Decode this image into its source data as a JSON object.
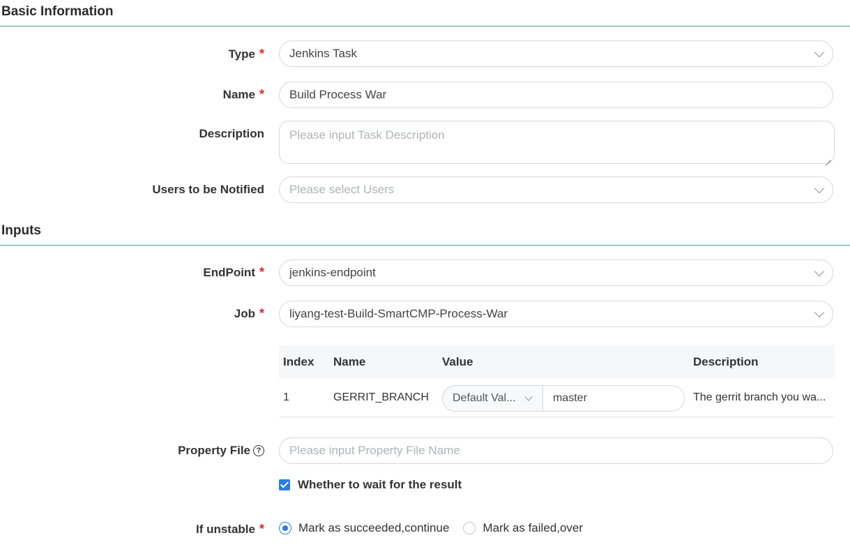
{
  "sections": {
    "basic": "Basic Information",
    "inputs": "Inputs"
  },
  "fields": {
    "type": {
      "label": "Type",
      "value": "Jenkins Task"
    },
    "name": {
      "label": "Name",
      "value": "Build Process War"
    },
    "description": {
      "label": "Description",
      "placeholder": "Please input Task Description"
    },
    "users": {
      "label": "Users to be Notified",
      "placeholder": "Please select Users"
    },
    "endpoint": {
      "label": "EndPoint",
      "value": "jenkins-endpoint"
    },
    "job": {
      "label": "Job",
      "value": "liyang-test-Build-SmartCMP-Process-War"
    },
    "property_file": {
      "label": "Property File",
      "placeholder": "Please input Property File Name"
    }
  },
  "required_mark": "*",
  "help_icon": "?",
  "params_table": {
    "headers": [
      "Index",
      "Name",
      "Value",
      "Description"
    ],
    "rows": [
      {
        "index": "1",
        "name": "GERRIT_BRANCH",
        "value_mode": "Default Val...",
        "value": "master",
        "description": "The gerrit branch you wa..."
      }
    ]
  },
  "wait_result": {
    "label": "Whether to wait for the result",
    "checked": true
  },
  "if_unstable": {
    "label": "If unstable",
    "options": [
      "Mark as succeeded,continue",
      "Mark as failed,over"
    ],
    "selected": 0
  },
  "colors": {
    "accent": "#2a7de1",
    "divider": "#3aa39b",
    "required": "#e0242c"
  }
}
